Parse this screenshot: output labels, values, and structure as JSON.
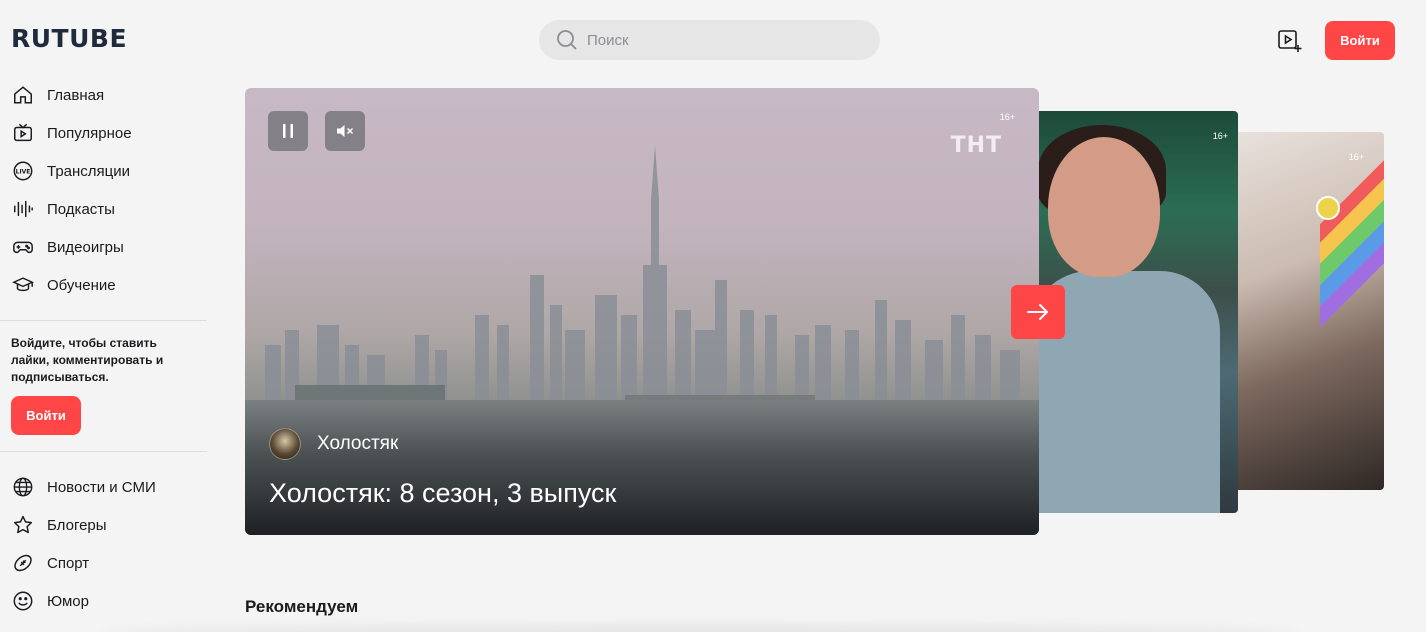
{
  "header": {
    "logo": "RUTUBE",
    "search_placeholder": "Поиск",
    "login_label": "Войти",
    "icons": [
      "search-icon",
      "upload-video-icon"
    ]
  },
  "sidebar": {
    "main_items": [
      {
        "label": "Главная",
        "icon": "home-icon"
      },
      {
        "label": "Популярное",
        "icon": "tv-icon"
      },
      {
        "label": "Трансляции",
        "icon": "live-icon"
      },
      {
        "label": "Подкасты",
        "icon": "audio-wave-icon"
      },
      {
        "label": "Видеоигры",
        "icon": "gamepad-icon"
      },
      {
        "label": "Обучение",
        "icon": "graduation-cap-icon"
      }
    ],
    "login_prompt": "Войдите, чтобы ставить лайки, комментировать и подписываться.",
    "login_label": "Войти",
    "category_items": [
      {
        "label": "Новости и СМИ",
        "icon": "globe-icon"
      },
      {
        "label": "Блогеры",
        "icon": "star-icon"
      },
      {
        "label": "Спорт",
        "icon": "football-icon"
      },
      {
        "label": "Юмор",
        "icon": "smile-icon"
      }
    ]
  },
  "hero": {
    "age_rating": "16+",
    "channel_watermark": "ТНТ",
    "channel_name": "Холостяк",
    "title": "Холостяк: 8 сезон, 3 выпуск",
    "side_cards": [
      {
        "age_rating": "16+"
      },
      {
        "age_rating": "16+"
      }
    ]
  },
  "sections": {
    "recommended_title": "Рекомендуем"
  },
  "colors": {
    "accent": "#ff4646",
    "background": "#f4f4f4",
    "logo": "#1f2a3c"
  }
}
